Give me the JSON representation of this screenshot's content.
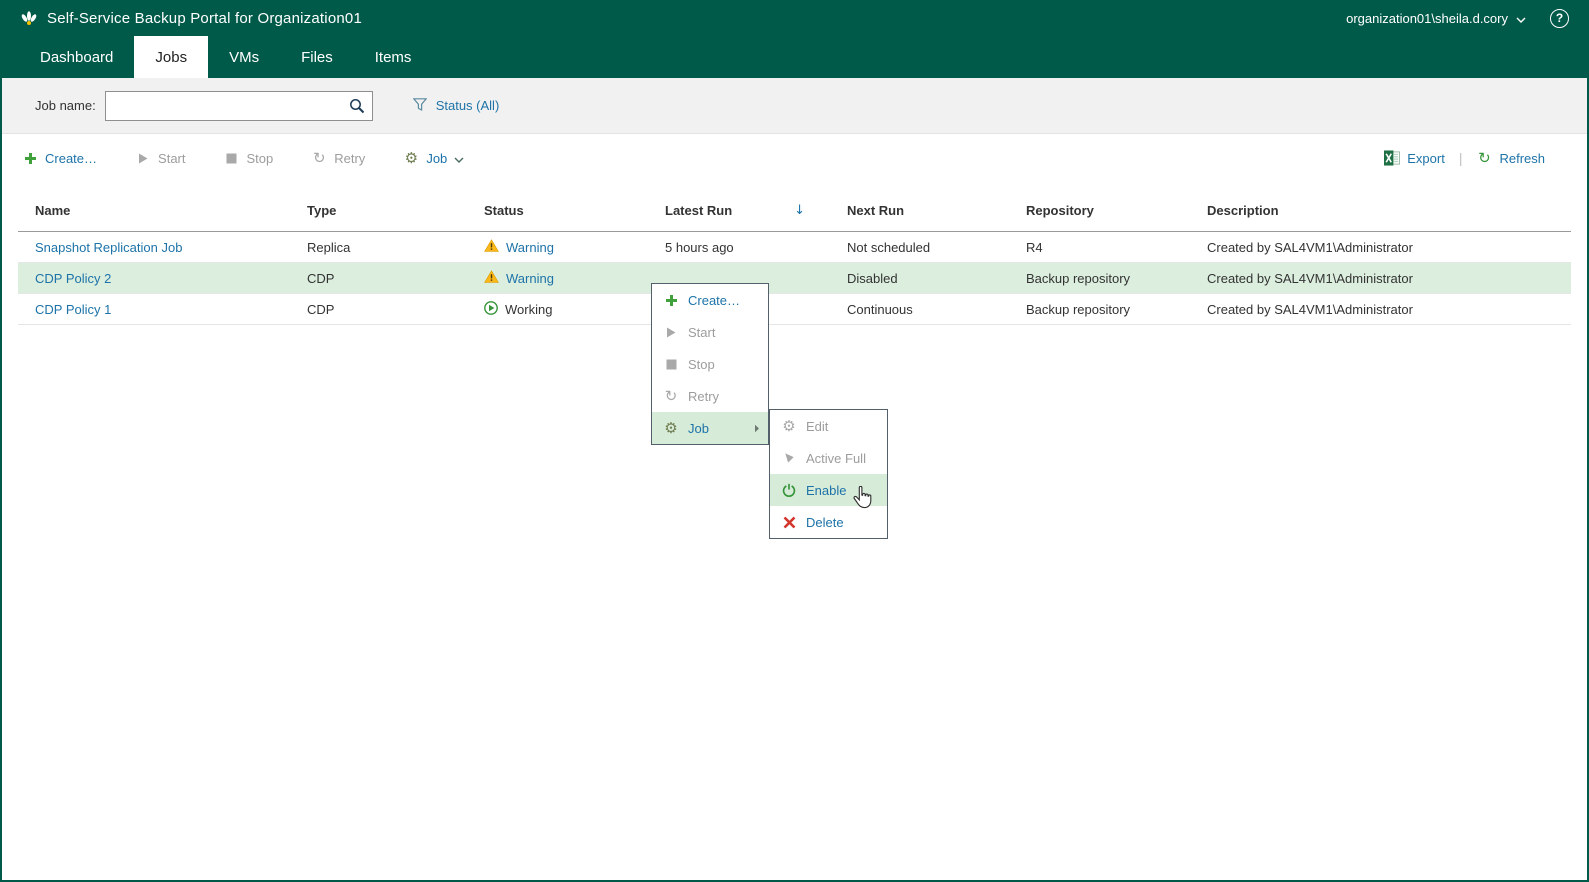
{
  "header": {
    "title": "Self-Service Backup Portal for Organization01",
    "user": "organization01\\sheila.d.cory",
    "help": "?"
  },
  "tabs": {
    "dashboard": "Dashboard",
    "jobs": "Jobs",
    "vms": "VMs",
    "files": "Files",
    "items": "Items"
  },
  "filters": {
    "job_name_label": "Job name:",
    "job_name_value": "",
    "status_filter": "Status (All)"
  },
  "toolbar": {
    "create": "Create…",
    "start": "Start",
    "stop": "Stop",
    "retry": "Retry",
    "job": "Job",
    "export": "Export",
    "refresh": "Refresh"
  },
  "table": {
    "columns": {
      "name": "Name",
      "type": "Type",
      "status": "Status",
      "latest_run": "Latest Run",
      "next_run": "Next Run",
      "repository": "Repository",
      "description": "Description"
    },
    "sort": {
      "column": "Latest Run",
      "direction": "desc",
      "arrow": "↓"
    },
    "rows": [
      {
        "name": "Snapshot Replication Job",
        "type": "Replica",
        "status": "Warning",
        "latest_run": "5 hours ago",
        "next_run": "Not scheduled",
        "repository": "R4",
        "description": "Created by SAL4VM1\\Administrator"
      },
      {
        "name": "CDP Policy 2",
        "type": "CDP",
        "status": "Warning",
        "latest_run": "",
        "next_run": "Disabled",
        "repository": "Backup repository",
        "description": "Created by SAL4VM1\\Administrator"
      },
      {
        "name": "CDP Policy 1",
        "type": "CDP",
        "status": "Working",
        "latest_run": "",
        "next_run": "Continuous",
        "repository": "Backup repository",
        "description": "Created by SAL4VM1\\Administrator"
      }
    ]
  },
  "context_menu": {
    "create": "Create…",
    "start": "Start",
    "stop": "Stop",
    "retry": "Retry",
    "job": "Job"
  },
  "submenu": {
    "edit": "Edit",
    "active_full": "Active Full",
    "enable": "Enable",
    "delete": "Delete"
  },
  "colors": {
    "brand_green": "#005a49",
    "selection_green": "#dceede",
    "link_blue": "#1d73a8",
    "warning_yellow": "#fcb81b",
    "status_green": "#36953a",
    "delete_red": "#d2352b",
    "excel_green": "#1f7145"
  }
}
